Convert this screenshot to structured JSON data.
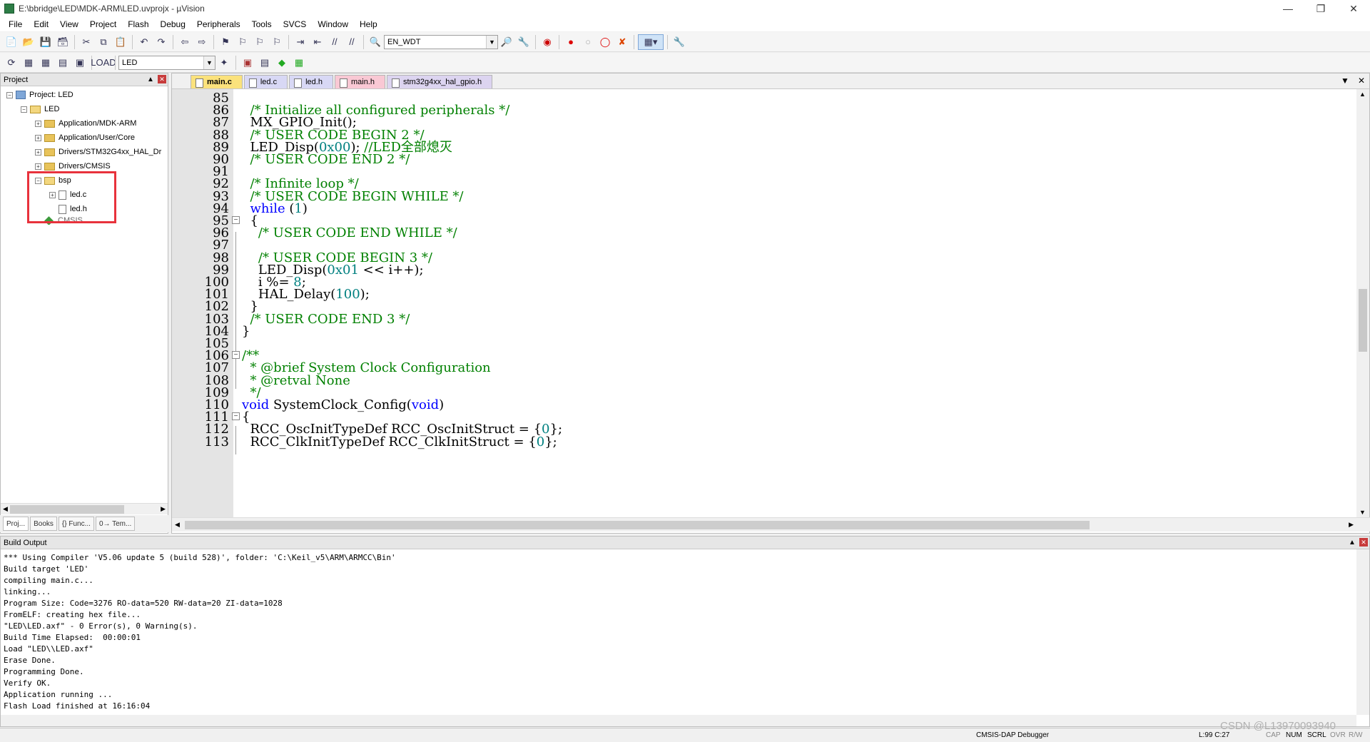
{
  "window": {
    "title": "E:\\bbridge\\LED\\MDK-ARM\\LED.uvprojx - µVision"
  },
  "menu": [
    "File",
    "Edit",
    "View",
    "Project",
    "Flash",
    "Debug",
    "Peripherals",
    "Tools",
    "SVCS",
    "Window",
    "Help"
  ],
  "toolbar1": {
    "combo_value": "EN_WDT"
  },
  "toolbar2": {
    "target_value": "LED"
  },
  "project_panel": {
    "title": "Project",
    "root": "Project: LED",
    "target": "LED",
    "groups": [
      "Application/MDK-ARM",
      "Application/User/Core",
      "Drivers/STM32G4xx_HAL_Dr",
      "Drivers/CMSIS",
      "bsp"
    ],
    "bsp_files": [
      "led.c",
      "led.h"
    ],
    "cmsis": "CMSIS",
    "tabs": [
      "Proj...",
      "Books",
      "{} Func...",
      "0→ Tem..."
    ]
  },
  "editor": {
    "tabs": [
      "main.c",
      "led.c",
      "led.h",
      "main.h",
      "stm32g4xx_hal_gpio.h"
    ],
    "active_tab": "main.c",
    "lines": [
      {
        "n": "85",
        "code": ""
      },
      {
        "n": "86",
        "code": "  /* Initialize all configured peripherals */"
      },
      {
        "n": "87",
        "code": "  MX_GPIO_Init();"
      },
      {
        "n": "88",
        "code": "  /* USER CODE BEGIN 2 */"
      },
      {
        "n": "89",
        "code": "  LED_Disp(0x00); //LED全部熄灭"
      },
      {
        "n": "90",
        "code": "  /* USER CODE END 2 */"
      },
      {
        "n": "91",
        "code": ""
      },
      {
        "n": "92",
        "code": "  /* Infinite loop */"
      },
      {
        "n": "93",
        "code": "  /* USER CODE BEGIN WHILE */"
      },
      {
        "n": "94",
        "code": "  while (1)"
      },
      {
        "n": "95",
        "code": "  {"
      },
      {
        "n": "96",
        "code": "    /* USER CODE END WHILE */"
      },
      {
        "n": "97",
        "code": ""
      },
      {
        "n": "98",
        "code": "    /* USER CODE BEGIN 3 */"
      },
      {
        "n": "99",
        "code": "    LED_Disp(0x01 << i++);"
      },
      {
        "n": "100",
        "code": "    i %= 8;"
      },
      {
        "n": "101",
        "code": "    HAL_Delay(100);"
      },
      {
        "n": "102",
        "code": "  }"
      },
      {
        "n": "103",
        "code": "  /* USER CODE END 3 */"
      },
      {
        "n": "104",
        "code": "}"
      },
      {
        "n": "105",
        "code": ""
      },
      {
        "n": "106",
        "code": "/**"
      },
      {
        "n": "107",
        "code": "  * @brief System Clock Configuration"
      },
      {
        "n": "108",
        "code": "  * @retval None"
      },
      {
        "n": "109",
        "code": "  */"
      },
      {
        "n": "110",
        "code": "void SystemClock_Config(void)"
      },
      {
        "n": "111",
        "code": "{"
      },
      {
        "n": "112",
        "code": "  RCC_OscInitTypeDef RCC_OscInitStruct = {0};"
      },
      {
        "n": "113",
        "code": "  RCC_ClkInitTypeDef RCC_ClkInitStruct = {0};"
      }
    ]
  },
  "build_output": {
    "title": "Build Output",
    "text": "*** Using Compiler 'V5.06 update 5 (build 528)', folder: 'C:\\Keil_v5\\ARM\\ARMCC\\Bin'\nBuild target 'LED'\ncompiling main.c...\nlinking...\nProgram Size: Code=3276 RO-data=520 RW-data=20 ZI-data=1028\nFromELF: creating hex file...\n\"LED\\LED.axf\" - 0 Error(s), 0 Warning(s).\nBuild Time Elapsed:  00:00:01\nLoad \"LED\\\\LED.axf\"\nErase Done.\nProgramming Done.\nVerify OK.\nApplication running ...\nFlash Load finished at 16:16:04"
  },
  "status_bar": {
    "debugger": "CMSIS-DAP Debugger",
    "position": "L:99 C:27",
    "caps": "CAP",
    "num": "NUM",
    "scrl": "SCRL",
    "ovr": "OVR",
    "rw": "R/W",
    "watermark": "CSDN @L13970093940"
  }
}
